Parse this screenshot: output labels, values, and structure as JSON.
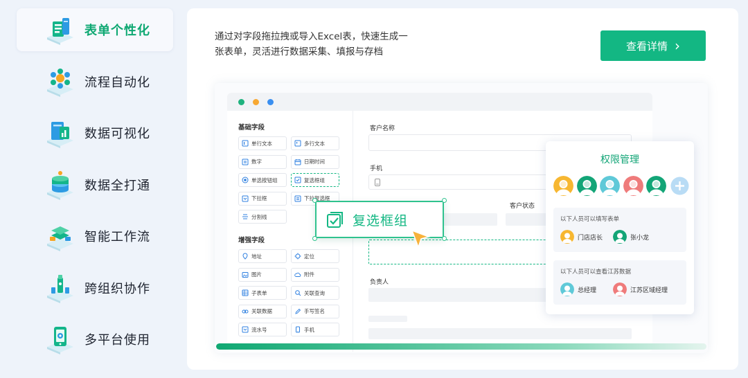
{
  "nav": [
    {
      "label": "表单个性化",
      "icon": "form-icon",
      "active": true
    },
    {
      "label": "流程自动化",
      "icon": "workflow-icon",
      "active": false
    },
    {
      "label": "数据可视化",
      "icon": "chart-icon",
      "active": false
    },
    {
      "label": "数据全打通",
      "icon": "database-icon",
      "active": false
    },
    {
      "label": "智能工作流",
      "icon": "smart-flow-icon",
      "active": false
    },
    {
      "label": "跨组织协作",
      "icon": "collaboration-icon",
      "active": false
    },
    {
      "label": "多平台使用",
      "icon": "multi-platform-icon",
      "active": false
    }
  ],
  "main": {
    "description_line1": "通过对字段拖拉拽或导入Excel表，快速生成一",
    "description_line2": "张表单，灵活进行数据采集、填报与存档",
    "detail_button": "查看详情",
    "accent_color": "#13b783"
  },
  "mockup": {
    "basic_section": "基础字段",
    "basic_fields": [
      "单行文本",
      "多行文本",
      "数字",
      "日期时间",
      "单选按钮组",
      "复选框组",
      "下拉框",
      "下拉复选框",
      "分割线"
    ],
    "advanced_section": "增强字段",
    "advanced_fields": [
      "地址",
      "定位",
      "图片",
      "附件",
      "子表单",
      "关联查询",
      "关联数据",
      "手写签名",
      "流水号",
      "手机"
    ],
    "form": {
      "customer_name": "客户名称",
      "phone": "手机",
      "customer_status": "客户状态",
      "owner": "负责人"
    },
    "drag_label": "复选框组"
  },
  "permission": {
    "title": "权限管理",
    "avatars": [
      "#f7b731",
      "#13a577",
      "#5fc9d8",
      "#ef7b7b",
      "#13a577"
    ],
    "group1_title": "以下人员可以填写表单",
    "group1_people": [
      "门店店长",
      "张小龙"
    ],
    "group2_title": "以下人员可以查看江苏数据",
    "group2_people": [
      "总经理",
      "江苏区域经理"
    ]
  },
  "progress": {
    "value": 1.0
  }
}
